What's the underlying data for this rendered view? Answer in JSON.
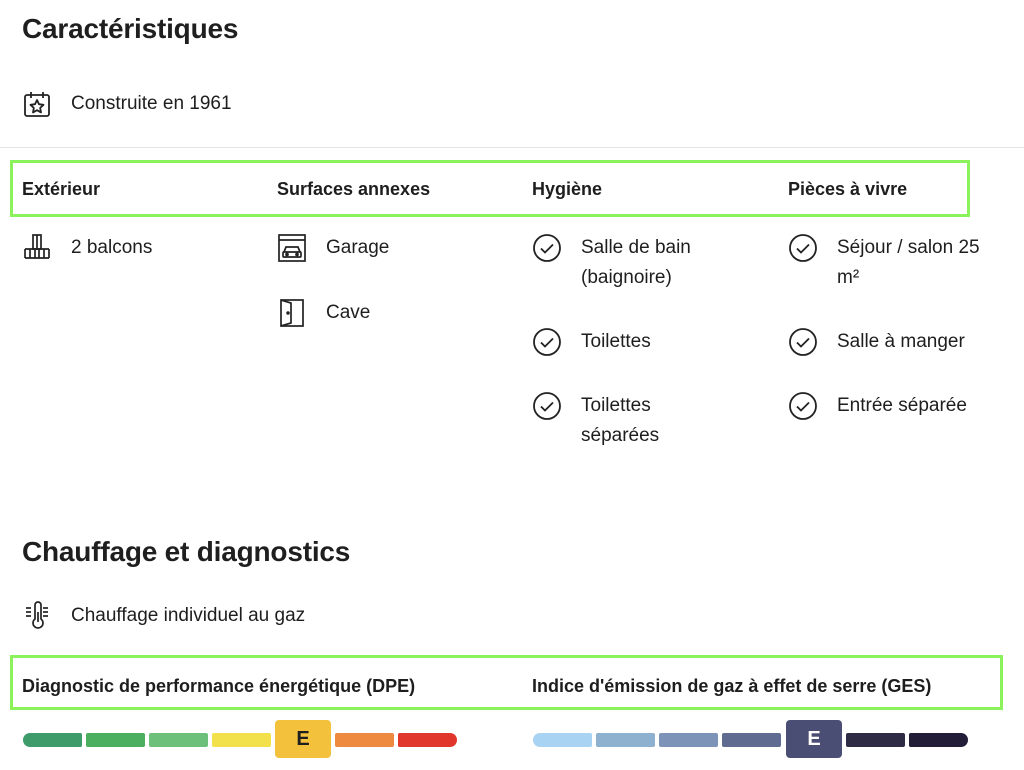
{
  "caracteristiques": {
    "title": "Caractéristiques",
    "construction": {
      "icon": "calendar-star-icon",
      "text": "Construite en 1961"
    },
    "columns": [
      {
        "title": "Extérieur",
        "items": [
          {
            "icon": "balcony-icon",
            "text": "2 balcons"
          }
        ]
      },
      {
        "title": "Surfaces annexes",
        "items": [
          {
            "icon": "garage-icon",
            "text": "Garage"
          },
          {
            "icon": "door-icon",
            "text": "Cave"
          }
        ]
      },
      {
        "title": "Hygiène",
        "items": [
          {
            "icon": "check-circle-icon",
            "text": "Salle de bain (baignoire)"
          },
          {
            "icon": "check-circle-icon",
            "text": "Toilettes"
          },
          {
            "icon": "check-circle-icon",
            "text": "Toilettes séparées"
          }
        ]
      },
      {
        "title": "Pièces à vivre",
        "items": [
          {
            "icon": "check-circle-icon",
            "text": "Séjour / salon 25 m²"
          },
          {
            "icon": "check-circle-icon",
            "text": "Salle à manger"
          },
          {
            "icon": "check-circle-icon",
            "text": "Entrée séparée"
          }
        ]
      }
    ]
  },
  "chauffage": {
    "title": "Chauffage et diagnostics",
    "heating": {
      "icon": "thermometer-icon",
      "text": "Chauffage individuel au gaz"
    },
    "dpe": {
      "title": "Diagnostic de performance énergétique (DPE)",
      "rating": "E",
      "scale_colors": [
        "#3e9c6a",
        "#4caf5f",
        "#6cc07a",
        "#f2e14a",
        "#f4c13d",
        "#ee8a3f",
        "#e0362c"
      ],
      "badge_color": "#f4c13d"
    },
    "ges": {
      "title": "Indice d'émission de gaz à effet de serre (GES)",
      "rating": "E",
      "scale_colors": [
        "#a9d3f2",
        "#8fb1d0",
        "#7d93b8",
        "#5f6b91",
        "#4b4e74",
        "#2e2b45",
        "#231d38"
      ],
      "badge_color": "#4b4e74"
    }
  }
}
